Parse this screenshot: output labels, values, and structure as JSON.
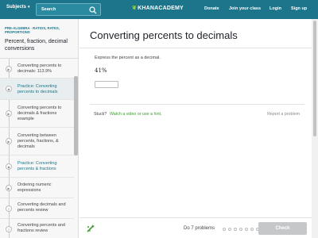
{
  "topbar": {
    "subjects": "Subjects",
    "search_placeholder": "Search",
    "logo": "KHANACADEMY",
    "links": [
      "Donate",
      "Join your class",
      "Login",
      "Sign up"
    ]
  },
  "sidebar": {
    "breadcrumb": "PRE-ALGEBRA · RATIOS, RATES, PROPORTIONS",
    "title": "Percent, fraction, decimal conversions",
    "items": [
      {
        "label": "Converting percents to decimals: 113.9%",
        "kind": "video"
      },
      {
        "label": "Practice: Converting percents to decimals",
        "kind": "practice"
      },
      {
        "label": "Converting percents to decimals & fractions example",
        "kind": "video"
      },
      {
        "label": "Converting between percents, fractions, & decimals",
        "kind": "video"
      },
      {
        "label": "Practice: Converting percents & fractions",
        "kind": "practice"
      },
      {
        "label": "Ordering numeric expressions",
        "kind": "video"
      },
      {
        "label": "Converting decimals and percents review",
        "kind": "article"
      },
      {
        "label": "Converting percents and fractions review",
        "kind": "article"
      }
    ]
  },
  "main": {
    "title": "Converting percents to decimals",
    "prompt": "Express the percent as a decimal.",
    "expression": "41%",
    "answer_value": "",
    "stuck": "Stuck?",
    "hint_link": "Watch a video or use a hint.",
    "report": "Report a problem"
  },
  "footer": {
    "do_problems": "Do 7 problems",
    "progress_dots": 7,
    "check": "Check"
  },
  "colors": {
    "brand": "#1c758a",
    "hint": "#3c9c2d",
    "check_disabled": "#c6c7c9"
  }
}
